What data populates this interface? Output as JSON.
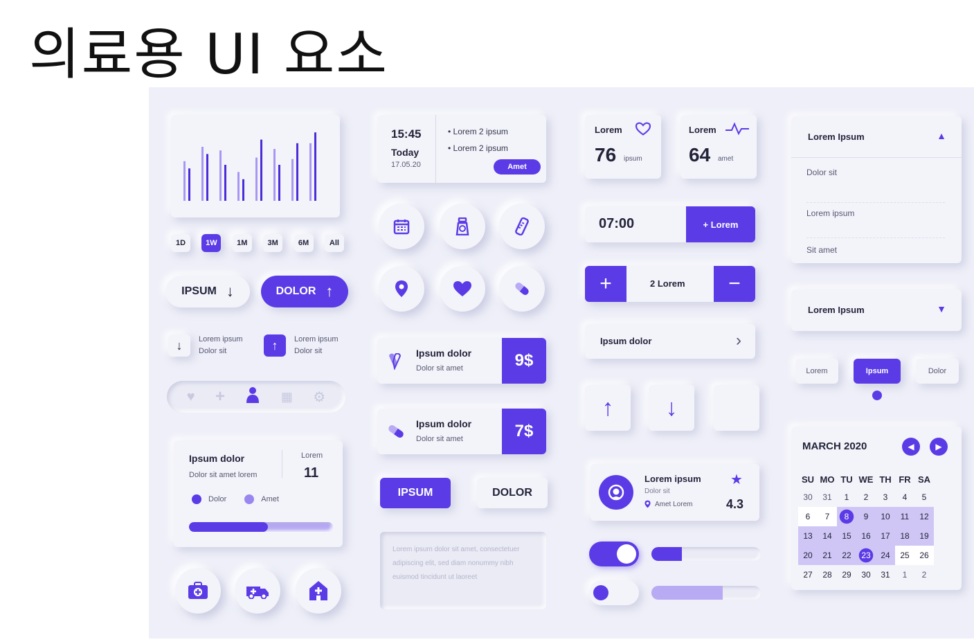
{
  "title": "의료용 UI 요소",
  "col1": {
    "chart_data": {
      "type": "bar",
      "series": [
        {
          "name": "",
          "values": [
            0.55,
            0.75,
            0.7,
            0.4,
            0.6,
            0.72,
            0.58,
            0.8
          ]
        },
        {
          "name": "",
          "values": [
            0.45,
            0.65,
            0.5,
            0.3,
            0.85,
            0.5,
            0.8,
            0.95
          ]
        }
      ],
      "ylim": [
        0,
        1
      ]
    },
    "ranges": [
      "1D",
      "1W",
      "1M",
      "3M",
      "6M",
      "All"
    ],
    "range_selected": "1W",
    "btn_ipsum": "IPSUM",
    "btn_dolor": "DOLOR",
    "item1": {
      "l1": "Lorem ipsum",
      "l2": "Dolor sit"
    },
    "item2": {
      "l1": "Lorem ipsum",
      "l2": "Dolor sit"
    },
    "stat": {
      "title": "Ipsum dolor",
      "sub": "Dolor sit amet lorem",
      "label": "Lorem",
      "value": "11",
      "leg1": "Dolor",
      "leg2": "Amet",
      "progress": 0.55
    }
  },
  "col2": {
    "time": "15:45",
    "today": "Today",
    "date": "17.05.20",
    "bullet1": "Lorem 2 ipsum",
    "bullet2": "Lorem 2 ipsum",
    "amet_btn": "Amet",
    "price1": {
      "title": "Ipsum dolor",
      "sub": "Dolor sit amet",
      "price": "9$"
    },
    "price2": {
      "title": "Ipsum dolor",
      "sub": "Dolor sit amet",
      "price": "7$"
    },
    "btn_ipsum": "IPSUM",
    "btn_dolor": "DOLOR",
    "textarea": "Lorem ipsum dolor sit amet, consectetuer adipiscing elit, sed diam nonummy nibh euismod tincidunt ut laoreet"
  },
  "col3": {
    "m1": {
      "label": "Lorem",
      "value": "76",
      "unit": "ipsum"
    },
    "m2": {
      "label": "Lorem",
      "value": "64",
      "unit": "amet"
    },
    "time_value": "07:00",
    "add_btn": "+ Lorem",
    "stepper_value": "2 Lorem",
    "nav_label": "Ipsum dolor",
    "doctor": {
      "name": "Lorem ipsum",
      "sub": "Dolor sit",
      "loc": "Amet Lorem",
      "rating": "4.3"
    },
    "slider1": 0.28,
    "slider2": 0.65
  },
  "col4": {
    "acc_title": "Lorem Ipsum",
    "acc_items": [
      "Dolor sit",
      "Lorem ipsum",
      "Sit amet"
    ],
    "select_title": "Lorem Ipsum",
    "seg": [
      "Lorem",
      "Ipsum",
      "Dolor"
    ],
    "cal_month": "MARCH 2020",
    "cal_days": [
      "SU",
      "MO",
      "TU",
      "WE",
      "TH",
      "FR",
      "SA"
    ],
    "cal_rows": [
      [
        "30",
        "31",
        "1",
        "2",
        "3",
        "4",
        "5"
      ],
      [
        "6",
        "7",
        "8",
        "9",
        "10",
        "11",
        "12"
      ],
      [
        "13",
        "14",
        "15",
        "16",
        "17",
        "18",
        "19"
      ],
      [
        "20",
        "21",
        "22",
        "23",
        "24",
        "25",
        "26"
      ],
      [
        "27",
        "28",
        "29",
        "30",
        "31",
        "1",
        "2"
      ]
    ]
  },
  "colors": {
    "accent": "#5b3be6",
    "bg": "#eeeff8"
  }
}
